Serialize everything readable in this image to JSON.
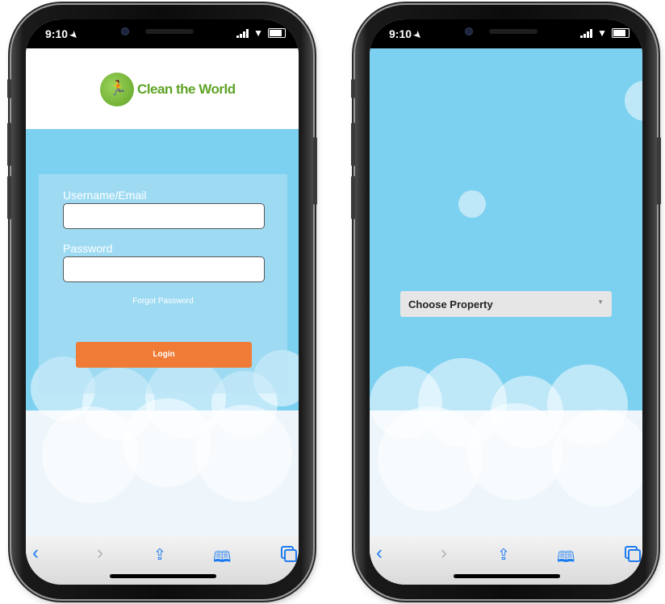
{
  "colors": {
    "sky": "#7cd0f0",
    "login_button": "#f07b36",
    "logo_green": "#5ea325",
    "toolbar_icon": "#1e7cf2"
  },
  "status_bar": {
    "time": "9:10",
    "location_icon": "location-arrow-icon",
    "signal_icon": "cellular-signal-icon",
    "wifi_icon": "wifi-icon",
    "battery_icon": "battery-icon"
  },
  "login_screen": {
    "logo_text": "Clean the World",
    "logo_icon": "clean-the-world-logo-icon",
    "username_label": "Username/Email",
    "username_value": "",
    "password_label": "Password",
    "password_value": "",
    "forgot_password": "Forgot Password",
    "login_button": "Login"
  },
  "property_screen": {
    "dropdown_value": "Choose Property",
    "dropdown_icon": "chevron-down-icon"
  },
  "toolbar": {
    "items": [
      {
        "icon": "back-chevron-icon"
      },
      {
        "icon": "forward-chevron-icon"
      },
      {
        "icon": "share-icon"
      },
      {
        "icon": "bookmarks-icon"
      },
      {
        "icon": "tabs-icon"
      }
    ]
  }
}
